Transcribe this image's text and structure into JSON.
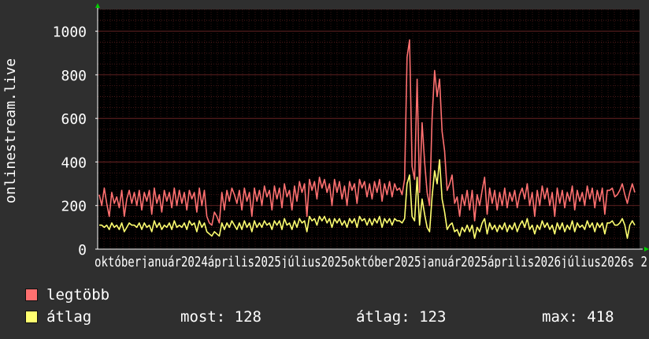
{
  "chart_data": {
    "type": "line",
    "ylabel": "onlinestream.live",
    "ylim": [
      0,
      1100
    ],
    "y_ticks": [
      0,
      200,
      400,
      600,
      800,
      1000
    ],
    "x_tick_labels": [
      "október",
      "január",
      "2024",
      "április",
      "2025",
      "július",
      "2025",
      "október",
      "2025",
      "január",
      "2025",
      "április",
      "2026",
      "július",
      "2026"
    ],
    "x_tick_labels_raw": "októberjanuár2024április2025július2025október2025január2025április2026július2026s 2",
    "grid": true,
    "background": "#000000",
    "colors": {
      "max": "#ff7070",
      "avg": "#ffff70",
      "grid": "#5a1e1e",
      "axis": "#ffffff",
      "arrow": "#00cc00"
    },
    "series": [
      {
        "name": "legtöbb",
        "values": [
          250,
          200,
          280,
          210,
          150,
          260,
          210,
          240,
          190,
          270,
          150,
          230,
          270,
          210,
          260,
          200,
          270,
          180,
          260,
          220,
          270,
          160,
          280,
          210,
          250,
          170,
          270,
          220,
          260,
          190,
          280,
          200,
          270,
          210,
          260,
          180,
          270,
          230,
          260,
          170,
          280,
          200,
          270,
          150,
          120,
          110,
          170,
          150,
          120,
          260,
          180,
          270,
          220,
          280,
          250,
          210,
          270,
          180,
          280,
          220,
          260,
          150,
          280,
          220,
          270,
          200,
          290,
          240,
          270,
          180,
          290,
          230,
          280,
          190,
          300,
          240,
          270,
          180,
          290,
          220,
          310,
          260,
          300,
          150,
          320,
          270,
          310,
          230,
          330,
          280,
          320,
          260,
          300,
          200,
          320,
          260,
          310,
          230,
          290,
          200,
          310,
          270,
          300,
          210,
          320,
          280,
          310,
          240,
          300,
          230,
          310,
          260,
          320,
          220,
          300,
          250,
          310,
          240,
          300,
          270,
          280,
          250,
          320,
          880,
          960,
          380,
          320,
          780,
          260,
          580,
          400,
          260,
          200,
          600,
          820,
          700,
          780,
          540,
          450,
          270,
          300,
          340,
          210,
          240,
          150,
          250,
          200,
          270,
          180,
          270,
          130,
          250,
          200,
          270,
          330,
          160,
          280,
          210,
          270,
          180,
          260,
          200,
          280,
          190,
          260,
          220,
          270,
          190,
          250,
          280,
          230,
          300,
          200,
          260,
          150,
          270,
          200,
          290,
          230,
          280,
          200,
          260,
          150,
          280,
          210,
          270,
          190,
          260,
          220,
          290,
          180,
          270,
          220,
          260,
          200,
          290,
          230,
          280,
          190,
          270,
          220,
          280,
          160,
          270,
          270,
          280,
          240,
          250,
          270,
          300,
          250,
          210,
          260,
          300,
          260
        ],
        "current": "",
        "average": "",
        "max_value": ""
      },
      {
        "name": "átlag",
        "values": [
          110,
          110,
          100,
          110,
          90,
          120,
          100,
          110,
          90,
          120,
          80,
          100,
          120,
          110,
          110,
          100,
          120,
          90,
          120,
          100,
          110,
          80,
          130,
          100,
          120,
          90,
          110,
          100,
          120,
          90,
          130,
          100,
          110,
          100,
          120,
          90,
          130,
          110,
          120,
          80,
          130,
          100,
          120,
          80,
          70,
          60,
          80,
          70,
          60,
          120,
          90,
          120,
          100,
          130,
          110,
          90,
          120,
          90,
          130,
          100,
          120,
          80,
          130,
          100,
          120,
          100,
          130,
          110,
          120,
          90,
          130,
          110,
          130,
          90,
          140,
          110,
          120,
          90,
          130,
          100,
          140,
          120,
          130,
          80,
          150,
          130,
          140,
          110,
          150,
          130,
          150,
          120,
          140,
          100,
          140,
          120,
          140,
          110,
          130,
          100,
          140,
          120,
          140,
          100,
          150,
          130,
          140,
          110,
          140,
          110,
          140,
          120,
          150,
          100,
          140,
          120,
          140,
          110,
          140,
          130,
          130,
          120,
          140,
          300,
          340,
          150,
          130,
          330,
          110,
          230,
          160,
          100,
          80,
          240,
          360,
          300,
          410,
          230,
          170,
          90,
          110,
          120,
          80,
          90,
          60,
          100,
          80,
          110,
          80,
          110,
          50,
          100,
          80,
          120,
          140,
          70,
          120,
          90,
          110,
          80,
          110,
          90,
          120,
          80,
          110,
          90,
          120,
          80,
          110,
          130,
          100,
          140,
          90,
          110,
          70,
          110,
          90,
          130,
          100,
          120,
          90,
          110,
          70,
          120,
          90,
          120,
          80,
          110,
          90,
          130,
          80,
          120,
          100,
          110,
          90,
          130,
          100,
          120,
          80,
          120,
          100,
          120,
          70,
          120,
          120,
          130,
          110,
          110,
          120,
          140,
          110,
          50,
          110,
          130,
          110
        ]
      }
    ]
  },
  "legend": {
    "items": [
      {
        "label": "legtöbb",
        "color": "#ff7070"
      },
      {
        "label": "átlag",
        "color": "#ffff70"
      }
    ],
    "stats": {
      "current": "most: 128",
      "average": "átlag: 123",
      "max": "max: 418"
    }
  }
}
